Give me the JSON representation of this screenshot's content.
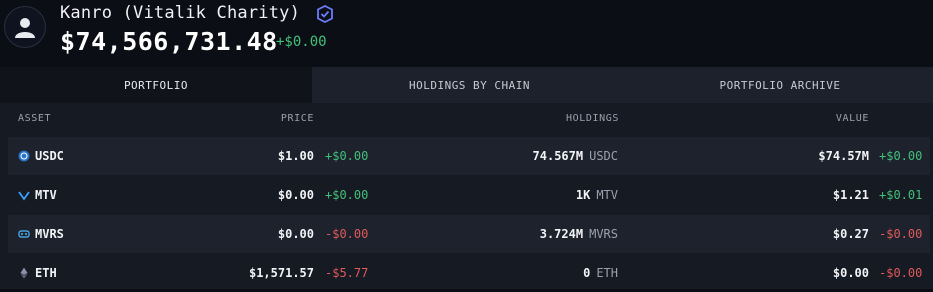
{
  "profile": {
    "name": "Kanro (Vitalik Charity)",
    "total_value": "$74,566,731.48",
    "total_change": "+$0.00"
  },
  "tabs": [
    {
      "label": "PORTFOLIO",
      "active": true
    },
    {
      "label": "HOLDINGS BY CHAIN",
      "active": false
    },
    {
      "label": "PORTFOLIO ARCHIVE",
      "active": false
    }
  ],
  "columns": {
    "asset": "ASSET",
    "price": "PRICE",
    "holdings": "HOLDINGS",
    "value": "VALUE"
  },
  "rows": [
    {
      "symbol": "USDC",
      "price": "$1.00",
      "price_change": "+$0.00",
      "holdings": "74.567M",
      "unit": "USDC",
      "value": "$74.57M",
      "value_change": "+$0.00",
      "icon": "usdc-icon"
    },
    {
      "symbol": "MTV",
      "price": "$0.00",
      "price_change": "+$0.00",
      "holdings": "1K",
      "unit": "MTV",
      "value": "$1.21",
      "value_change": "+$0.01",
      "icon": "mtv-icon"
    },
    {
      "symbol": "MVRS",
      "price": "$0.00",
      "price_change": "-$0.00",
      "holdings": "3.724M",
      "unit": "MVRS",
      "value": "$0.27",
      "value_change": "-$0.00",
      "icon": "mvrs-icon"
    },
    {
      "symbol": "ETH",
      "price": "$1,571.57",
      "price_change": "-$5.77",
      "holdings": "0",
      "unit": "ETH",
      "value": "$0.00",
      "value_change": "-$0.00",
      "icon": "eth-icon"
    }
  ],
  "colors": {
    "positive": "#42c07a",
    "negative": "#e05a5a",
    "background": "#0b0e15",
    "panel": "#161a22"
  }
}
